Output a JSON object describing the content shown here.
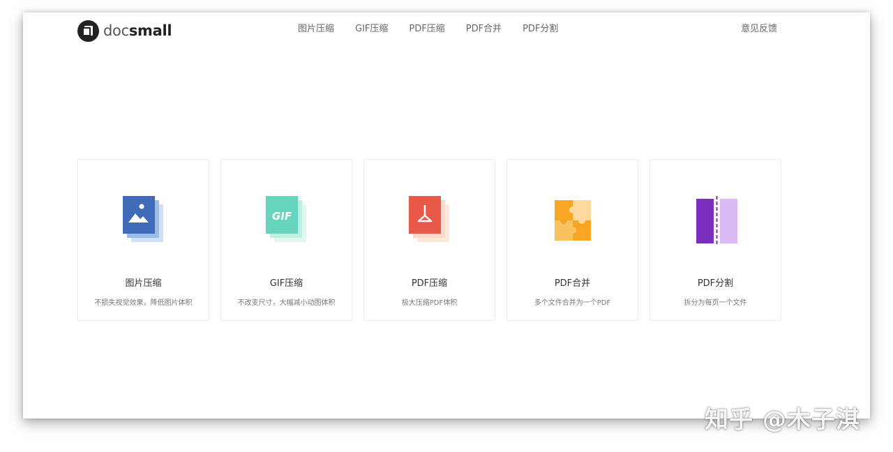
{
  "header": {
    "logo": {
      "text_light": "doc",
      "text_bold": "small"
    },
    "nav": [
      {
        "label": "图片压缩"
      },
      {
        "label": "GIF压缩"
      },
      {
        "label": "PDF压缩"
      },
      {
        "label": "PDF合并"
      },
      {
        "label": "PDF分割"
      }
    ],
    "feedback": "意见反馈"
  },
  "cards": [
    {
      "title": "图片压缩",
      "desc": "不损失视觉效果，降低图片体积",
      "icon": "image-compress-icon",
      "color": "#3f6bb8",
      "color_back": "#9ebce8"
    },
    {
      "title": "GIF压缩",
      "desc": "不改变尺寸，大幅减小动图体积",
      "icon": "gif-compress-icon",
      "icon_text": "GIF",
      "color": "#67d4be",
      "color_back": "#bfeee3"
    },
    {
      "title": "PDF压缩",
      "desc": "极大压缩PDF体积",
      "icon": "pdf-compress-icon",
      "color": "#e8594a",
      "color_back": "#fbd8c8"
    },
    {
      "title": "PDF合并",
      "desc": "多个文件合并为一个PDF",
      "icon": "pdf-merge-icon",
      "color": "#f6a623",
      "color_back": "#fcd89c"
    },
    {
      "title": "PDF分割",
      "desc": "拆分为每页一个文件",
      "icon": "pdf-split-icon",
      "color": "#7b2fbe",
      "color_back": "#dcb8f5"
    }
  ],
  "watermark": "知乎 @木子淇"
}
